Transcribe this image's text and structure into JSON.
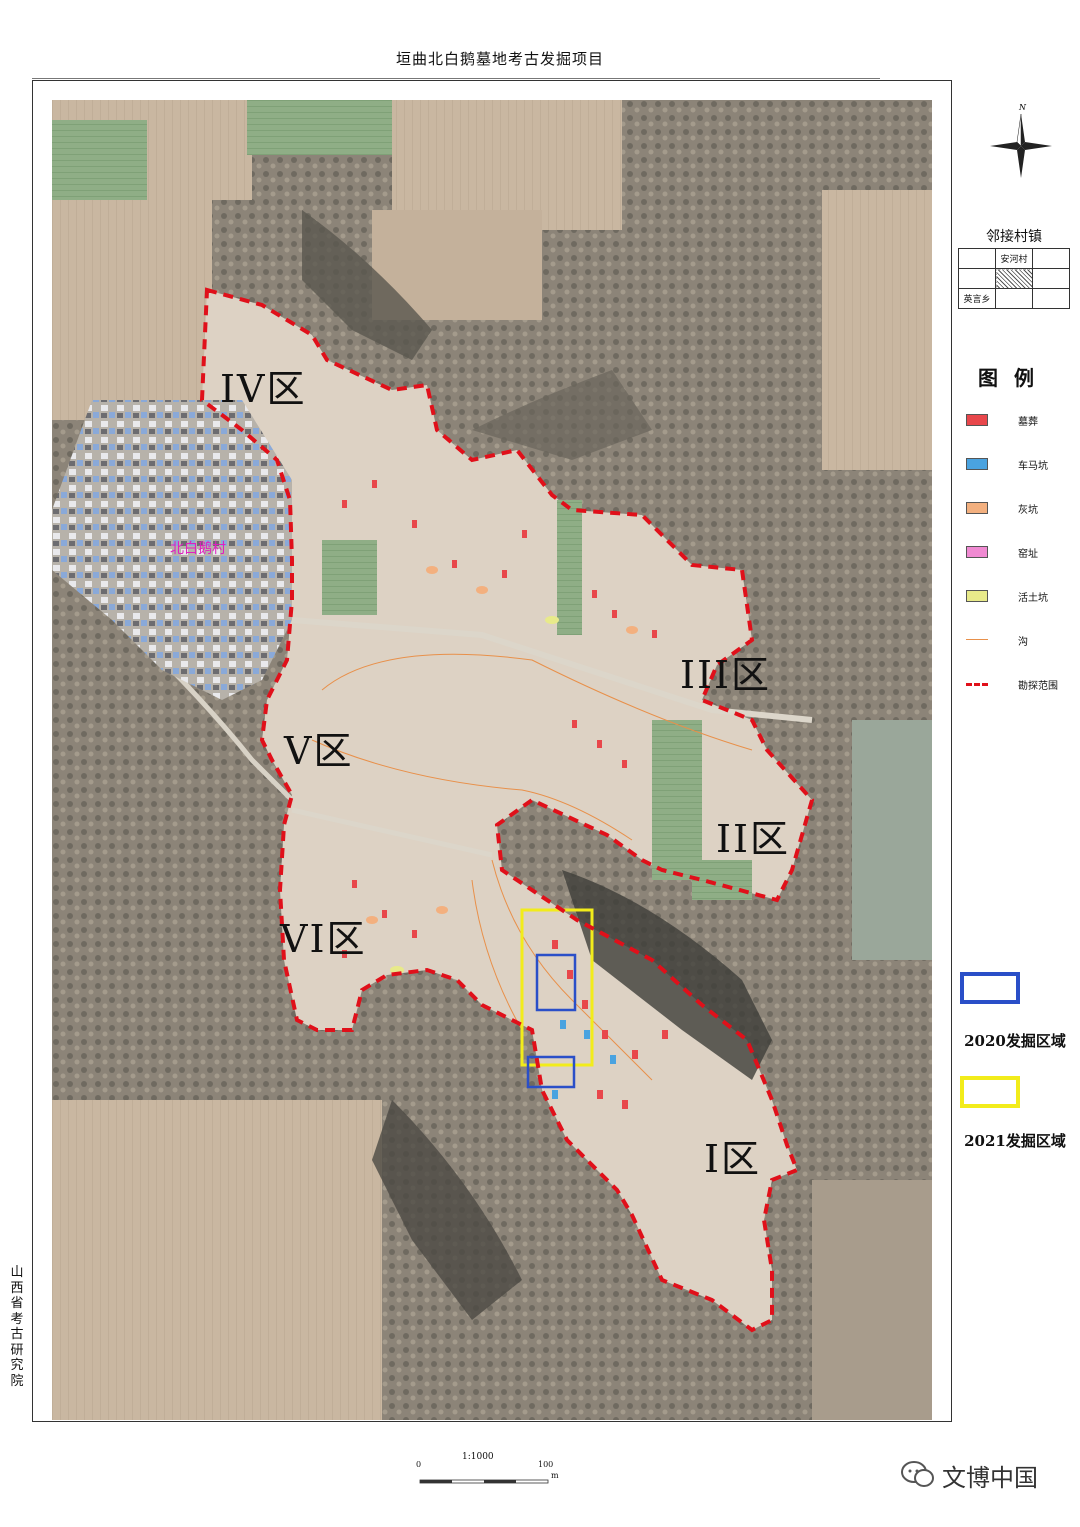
{
  "title": "垣曲北白鹅墓地考古发掘项目",
  "village": "北白鹅村",
  "zones": [
    {
      "label": "IV区"
    },
    {
      "label": "III区"
    },
    {
      "label": "V区"
    },
    {
      "label": "II区"
    },
    {
      "label": "VI区"
    },
    {
      "label": "I区"
    }
  ],
  "north_label": "N",
  "adjacent": {
    "title": "邻接村镇",
    "cells": [
      "",
      "安河村",
      "",
      "",
      "",
      "",
      "英言乡",
      "",
      ""
    ]
  },
  "legend": {
    "title": "图例",
    "items": [
      {
        "label": "墓葬",
        "color": "#e8474b",
        "kind": "box"
      },
      {
        "label": "车马坑",
        "color": "#4aa3e0",
        "kind": "box"
      },
      {
        "label": "灰坑",
        "color": "#f3b07f",
        "kind": "box"
      },
      {
        "label": "窑址",
        "color": "#f08ad2",
        "kind": "box"
      },
      {
        "label": "活土坑",
        "color": "#e8ea8a",
        "kind": "box"
      },
      {
        "label": "沟",
        "color": "#e8904a",
        "kind": "line"
      },
      {
        "label": "勘探范围",
        "color": "#e0101a",
        "kind": "dash"
      }
    ]
  },
  "excavations": [
    {
      "label": "2020发掘区域",
      "color": "#2a4fc8"
    },
    {
      "label": "2021发掘区域",
      "color": "#f2ec1a"
    }
  ],
  "org": "山西省考古研究院",
  "scale": {
    "ratio": "1:1000",
    "start": "0",
    "end": "100",
    "unit": "m"
  },
  "watermark": "文博中国"
}
